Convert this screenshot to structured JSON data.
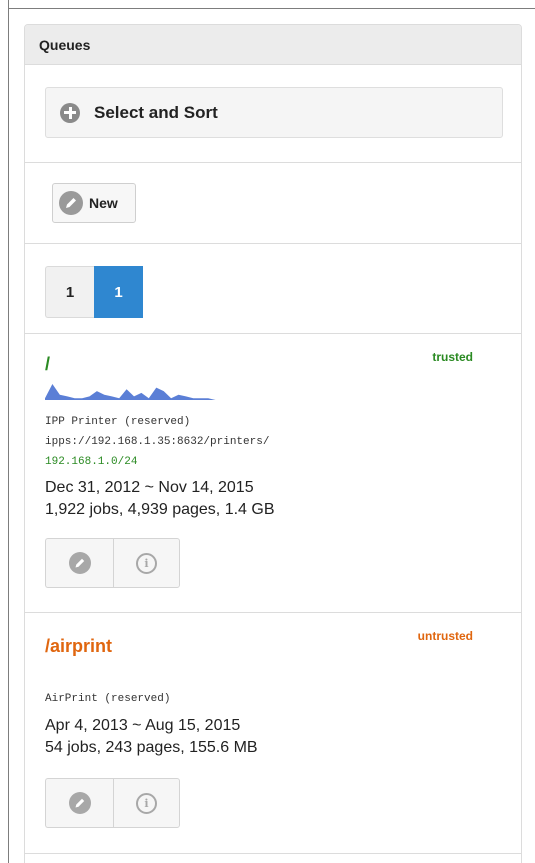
{
  "panel": {
    "heading": "Queues"
  },
  "select_sort": {
    "label": "Select and Sort",
    "icon": "plus-circle-icon"
  },
  "toolbar": {
    "new_label": "New",
    "new_icon": "pencil-icon"
  },
  "pagination": {
    "pages": [
      "1",
      "1"
    ],
    "active_index": 1,
    "active_color": "#2f87d0"
  },
  "queues": [
    {
      "path": "/",
      "trust": "trusted",
      "color": "#2a8a22",
      "sparkline": [
        1,
        9,
        3,
        2,
        1,
        1,
        2,
        5,
        3,
        2,
        1,
        6,
        2,
        4,
        1,
        7,
        5,
        1,
        3,
        2,
        1,
        1,
        1,
        0,
        0
      ],
      "description": "IPP Printer (reserved)",
      "uri": "ipps://192.168.1.35:8632/printers/",
      "network": "192.168.1.0/24",
      "dates": "Dec 31, 2012 ~ Nov 14, 2015",
      "stats": "1,922 jobs, 4,939 pages, 1.4 GB"
    },
    {
      "path": "/airprint",
      "trust": "untrusted",
      "color": "#e0660f",
      "description": "AirPrint (reserved)",
      "dates": "Apr 4, 2013 ~ Aug 15, 2015",
      "stats": "54 jobs, 243 pages, 155.6 MB"
    }
  ]
}
